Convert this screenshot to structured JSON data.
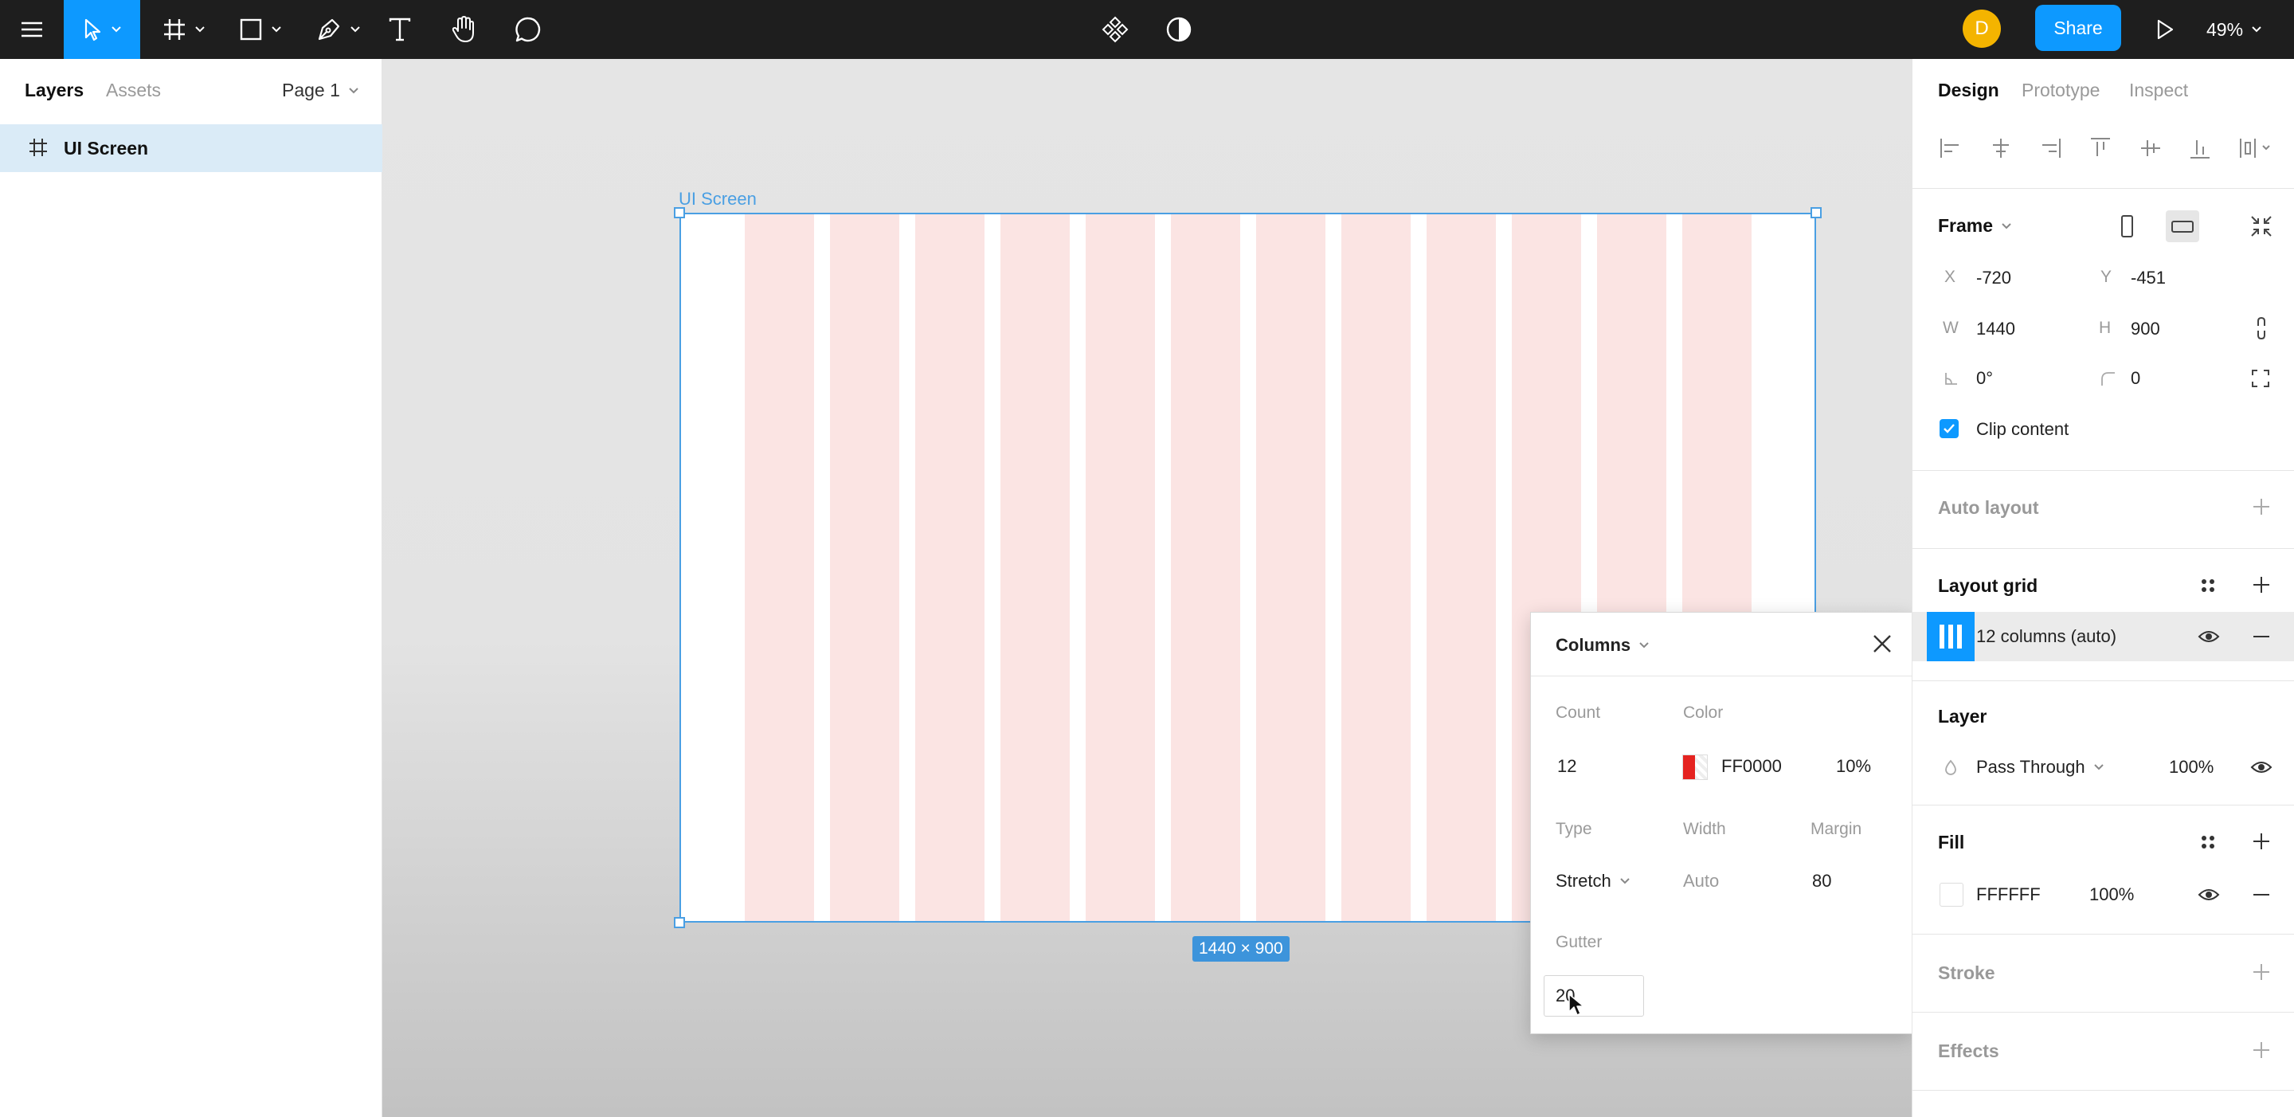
{
  "toolbar": {
    "avatar_initial": "D",
    "share_label": "Share",
    "zoom_label": "49%"
  },
  "left_panel": {
    "tabs": [
      {
        "label": "Layers",
        "active": true
      },
      {
        "label": "Assets",
        "active": false
      }
    ],
    "page_selector": "Page 1",
    "layers": [
      {
        "name": "UI Screen",
        "icon": "frame-icon",
        "selected": true
      }
    ]
  },
  "canvas": {
    "frame_label": "UI Screen",
    "size_badge": "1440 × 900",
    "grid_color": "#FF0000",
    "grid_column_count": 12
  },
  "columns_popover": {
    "title": "Columns",
    "count_label": "Count",
    "count_value": "12",
    "color_label": "Color",
    "color_hex": "FF0000",
    "color_opacity": "10%",
    "type_label": "Type",
    "type_value": "Stretch",
    "width_label": "Width",
    "width_value": "Auto",
    "margin_label": "Margin",
    "margin_value": "80",
    "gutter_label": "Gutter",
    "gutter_value": "20"
  },
  "right_panel": {
    "tabs": [
      {
        "label": "Design",
        "active": true
      },
      {
        "label": "Prototype",
        "active": false
      },
      {
        "label": "Inspect",
        "active": false
      }
    ],
    "frame": {
      "title": "Frame",
      "x_label": "X",
      "x_value": "-720",
      "y_label": "Y",
      "y_value": "-451",
      "w_label": "W",
      "w_value": "1440",
      "h_label": "H",
      "h_value": "900",
      "rotation_value": "0°",
      "radius_value": "0",
      "clip_content_label": "Clip content",
      "clip_content_checked": true
    },
    "auto_layout": {
      "title": "Auto layout"
    },
    "layout_grid": {
      "title": "Layout grid",
      "item_label": "12 columns (auto)"
    },
    "layer": {
      "title": "Layer",
      "blend_mode": "Pass Through",
      "opacity": "100%"
    },
    "fill": {
      "title": "Fill",
      "hex": "FFFFFF",
      "opacity": "100%"
    },
    "stroke": {
      "title": "Stroke"
    },
    "effects": {
      "title": "Effects"
    }
  },
  "colors": {
    "accent": "#0D99FF",
    "toolbar_bg": "#1E1E1E",
    "selection": "#4A9FE3",
    "column_fill": "#FBE4E3"
  }
}
